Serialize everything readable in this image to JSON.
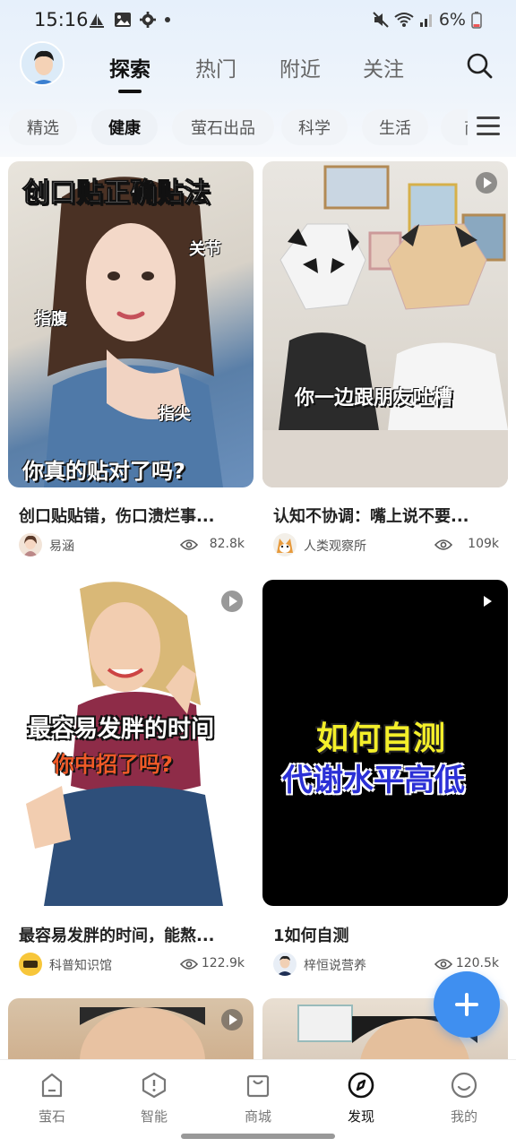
{
  "status_bar": {
    "time": "15:16",
    "battery": "6%"
  },
  "header": {
    "tabs": [
      {
        "label": "探索",
        "active": true
      },
      {
        "label": "热门",
        "active": false
      },
      {
        "label": "附近",
        "active": false
      },
      {
        "label": "关注",
        "active": false
      }
    ]
  },
  "categories": [
    {
      "label": "精选",
      "active": false
    },
    {
      "label": "健康",
      "active": true
    },
    {
      "label": "萤石出品",
      "active": false
    },
    {
      "label": "科学",
      "active": false
    },
    {
      "label": "生活",
      "active": false
    },
    {
      "label": "商",
      "active": false
    }
  ],
  "feed": [
    {
      "overlay": [
        "创口贴正确贴法",
        "关节",
        "指腹",
        "指尖",
        "你真的贴对了吗?"
      ],
      "title": "创口贴贴错，伤口溃烂事...",
      "author": "易涵",
      "views": "82.8k",
      "has_play": false
    },
    {
      "overlay": [
        "你一边跟朋友吐槽"
      ],
      "title": "认知不协调：嘴上说不要...",
      "author": "人类观察所",
      "views": "109k",
      "has_play": true
    },
    {
      "overlay": [
        "最容易发胖的时间",
        "你中招了吗?"
      ],
      "title": "最容易发胖的时间，能熬...",
      "author": "科普知识馆",
      "views": "122.9k",
      "has_play": true
    },
    {
      "overlay": [
        "如何自测",
        "代谢水平高低"
      ],
      "title": "1如何自测",
      "author": "梓恒说营养",
      "views": "120.5k",
      "has_play": true
    }
  ],
  "bottom_nav": [
    {
      "label": "萤石",
      "icon": "home-icon",
      "active": false
    },
    {
      "label": "智能",
      "icon": "smart-hex-icon",
      "active": false
    },
    {
      "label": "商城",
      "icon": "shop-bag-icon",
      "active": false
    },
    {
      "label": "发现",
      "icon": "compass-icon",
      "active": true
    },
    {
      "label": "我的",
      "icon": "smile-face-icon",
      "active": false
    }
  ],
  "colors": {
    "accent": "#3f8ff0",
    "text_primary": "#222222",
    "text_secondary": "#555555"
  }
}
